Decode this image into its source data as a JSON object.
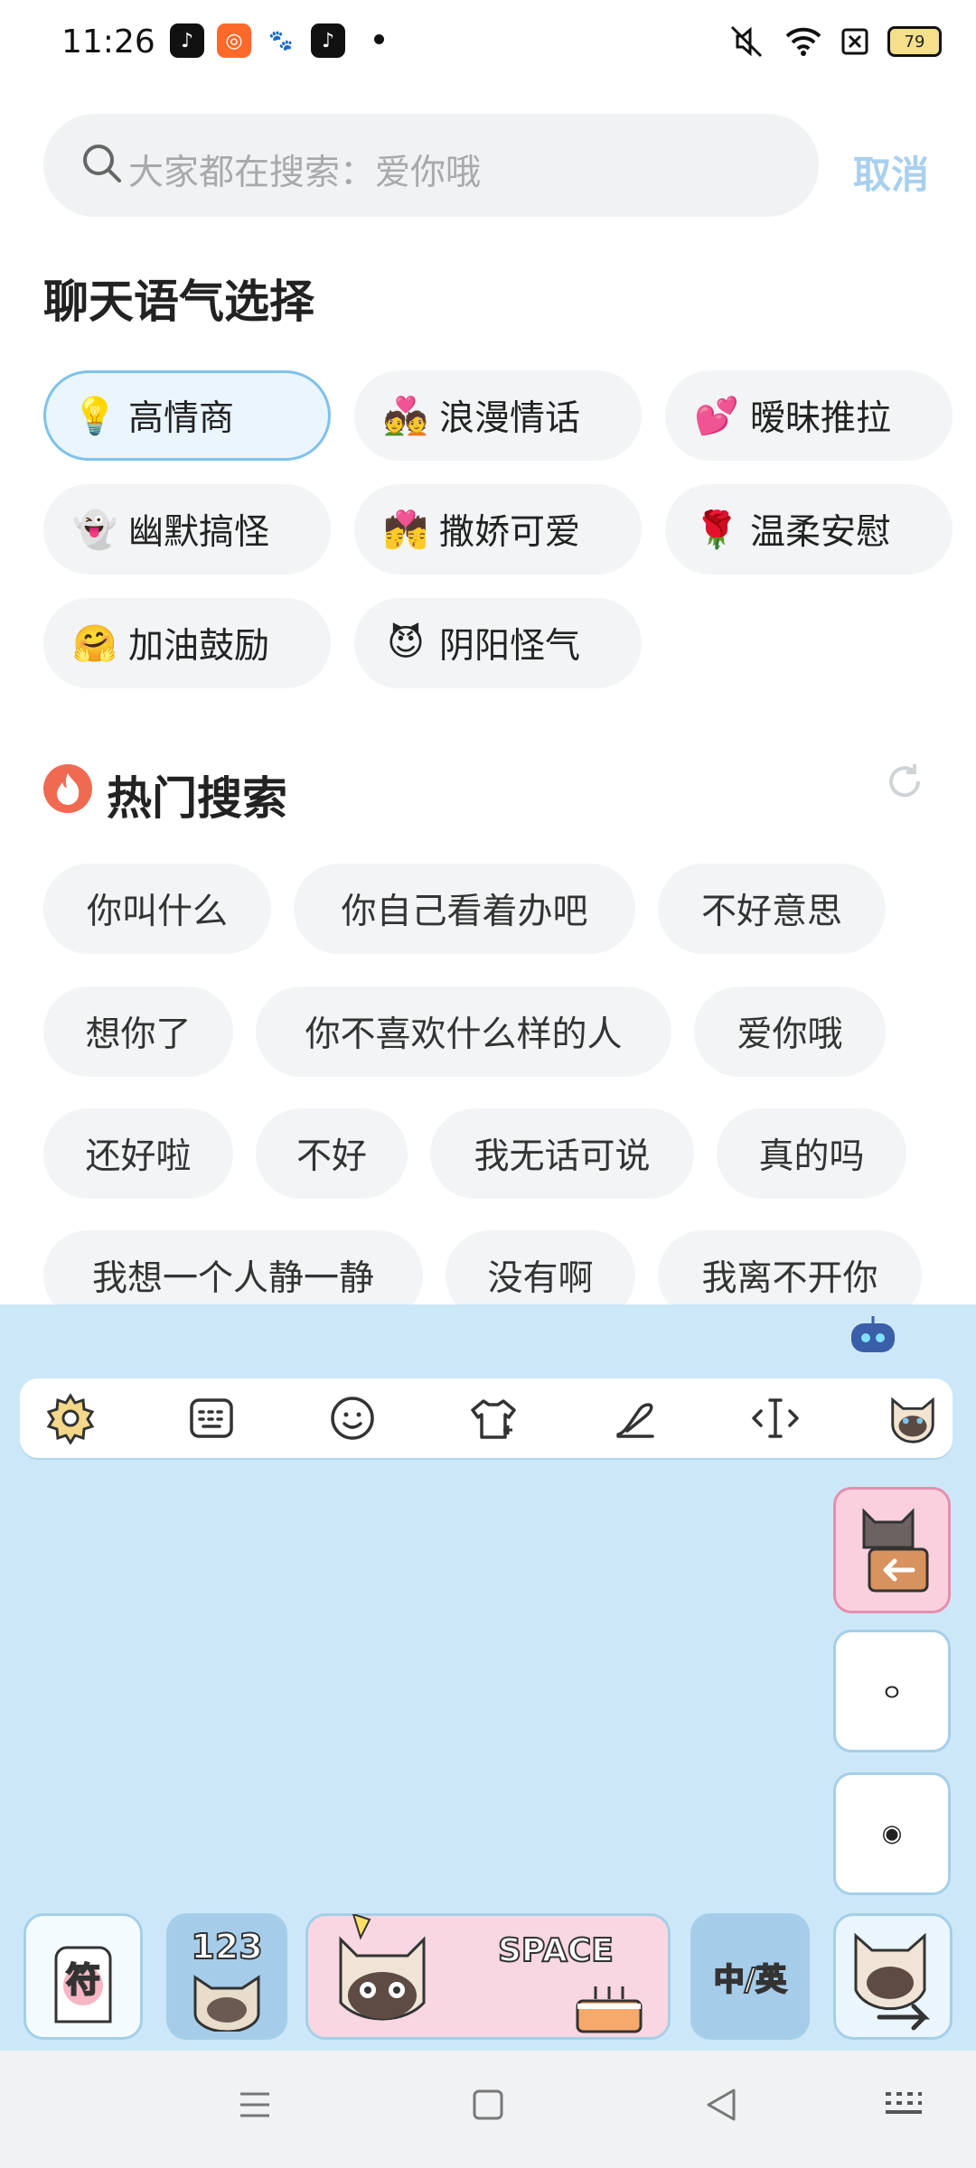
{
  "status_bar": {
    "time": "11:26",
    "battery": "79",
    "icons": [
      "douyin-icon",
      "kuaishou-icon",
      "baidu-icon",
      "tiktok-icon",
      "mute-icon",
      "wifi-icon",
      "sim-icon",
      "battery-icon"
    ]
  },
  "search": {
    "placeholder": "大家都在搜索：爱你哦",
    "cancel": "取消"
  },
  "tone_section": {
    "title": "聊天语气选择",
    "chips": [
      {
        "emoji": "💡",
        "label": "高情商",
        "selected": true
      },
      {
        "emoji": "💑",
        "label": "浪漫情话"
      },
      {
        "emoji": "💕",
        "label": "暧昧推拉"
      },
      {
        "emoji": "👻",
        "label": "幽默搞怪"
      },
      {
        "emoji": "💏",
        "label": "撒娇可爱"
      },
      {
        "emoji": "🌹",
        "label": "温柔安慰"
      },
      {
        "emoji": "🤗",
        "label": "加油鼓励"
      },
      {
        "emoji": "😈",
        "label": "阴阳怪气"
      }
    ]
  },
  "hot_section": {
    "title": "热门搜索",
    "items": [
      "你叫什么",
      "你自己看着办吧",
      "不好意思",
      "想你了",
      "你不喜欢什么样的人",
      "爱你哦",
      "还好啦",
      "不好",
      "我无话可说",
      "真的吗",
      "我想一个人静一静",
      "没有啊",
      "我离不开你"
    ]
  },
  "keyboard": {
    "toolbar": [
      "settings-icon",
      "keyboard-layout-icon",
      "emoji-icon",
      "skin-icon",
      "handwriting-icon",
      "cursor-icon",
      "cat-theme-icon"
    ],
    "side_keys": [
      {
        "label": "",
        "name": "backspace-key"
      },
      {
        "label": "ㅇ",
        "name": "side-key-1"
      },
      {
        "label": "◉",
        "name": "side-key-2"
      }
    ],
    "symbol_key": "符",
    "number_key": "123",
    "space_key": "SPACE",
    "lang_key": "中/英"
  }
}
